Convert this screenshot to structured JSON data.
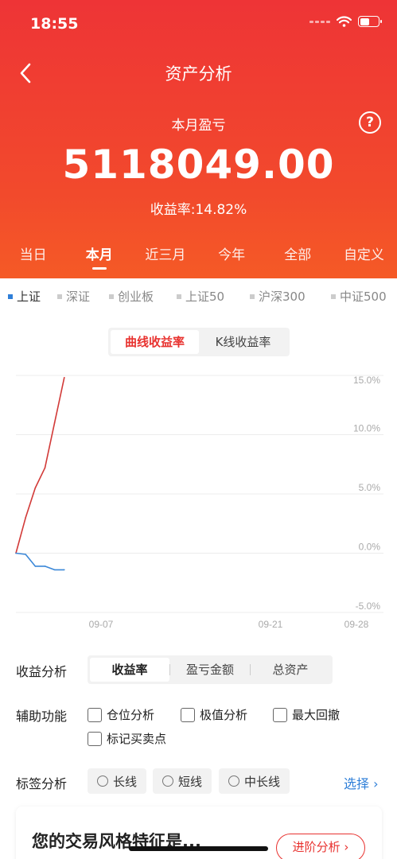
{
  "status": {
    "time": "18:55"
  },
  "nav": {
    "title": "资产分析"
  },
  "summary": {
    "label": "本月盈亏",
    "value": "5118049.00",
    "yield_label": "收益率:",
    "yield_value": "14.82%"
  },
  "period_tabs": [
    "当日",
    "本月",
    "近三月",
    "今年",
    "全部",
    "自定义"
  ],
  "period_active": "本月",
  "indices": [
    "上证",
    "深证",
    "创业板",
    "上证50",
    "沪深300",
    "中证500"
  ],
  "index_active": "上证",
  "chart_mode": {
    "options": [
      "曲线收益率",
      "K线收益率"
    ],
    "active": "曲线收益率"
  },
  "chart_data": {
    "type": "line",
    "y_unit": "%",
    "ylim": [
      -5,
      15
    ],
    "yticks": [
      "15.0%",
      "10.0%",
      "5.0%",
      "0.0%",
      "-5.0%"
    ],
    "xticks": [
      "09-07",
      "09-21",
      "09-28"
    ],
    "series": [
      {
        "color": "#d23a38",
        "x": [
          "09-01",
          "09-02",
          "09-03",
          "09-04",
          "09-05",
          "09-06"
        ],
        "values": [
          0.0,
          3.0,
          5.5,
          7.2,
          11.0,
          14.82
        ]
      },
      {
        "color": "#3b88d8",
        "x": [
          "09-01",
          "09-02",
          "09-03",
          "09-04",
          "09-05",
          "09-06"
        ],
        "values": [
          0.0,
          -0.1,
          -1.1,
          -1.1,
          -1.4,
          -1.4
        ]
      }
    ]
  },
  "income_analysis": {
    "label": "收益分析",
    "options": [
      "收益率",
      "盈亏金额",
      "总资产"
    ],
    "active": "收益率"
  },
  "aux": {
    "label": "辅助功能",
    "options": [
      "仓位分析",
      "极值分析",
      "最大回撤",
      "标记买卖点"
    ]
  },
  "tag_analysis": {
    "label": "标签分析",
    "options": [
      "长线",
      "短线",
      "中长线"
    ],
    "select": "选择"
  },
  "style_card": {
    "title": "您的交易风格特征是...",
    "button": "进阶分析"
  }
}
